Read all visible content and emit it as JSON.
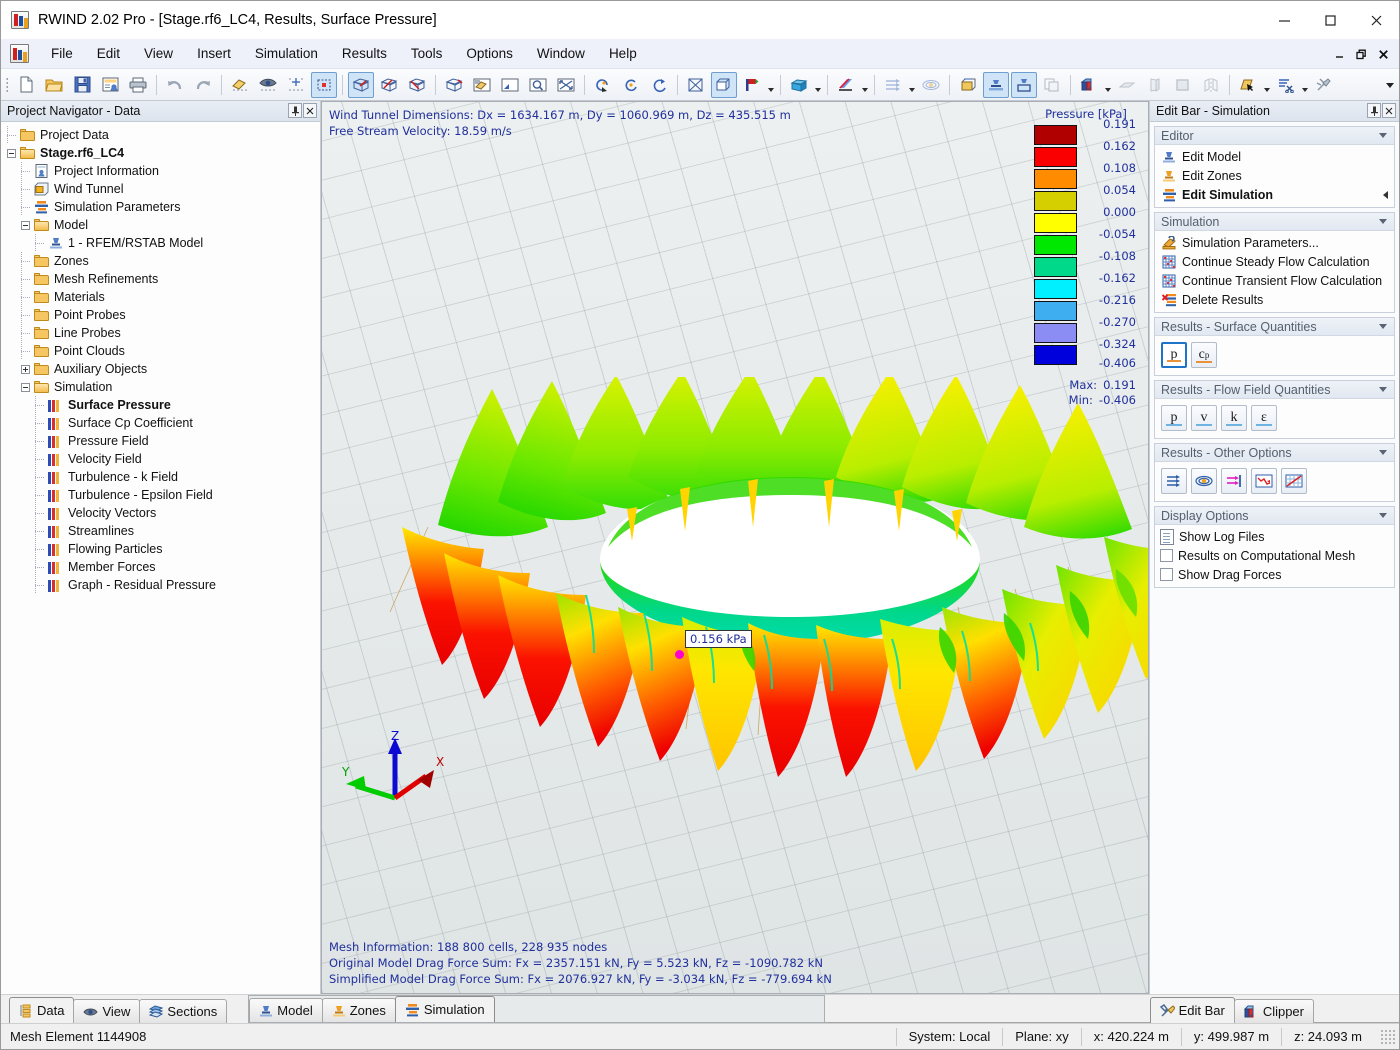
{
  "window": {
    "title": "RWIND 2.02 Pro - [Stage.rf6_LC4, Results, Surface Pressure]",
    "minimize": "—",
    "maximize": "☐",
    "close": "✕"
  },
  "mdi": {
    "minimize": "–",
    "restore": "❐",
    "close": "✕"
  },
  "menu": [
    {
      "label": "File"
    },
    {
      "label": "Edit"
    },
    {
      "label": "View"
    },
    {
      "label": "Insert"
    },
    {
      "label": "Simulation"
    },
    {
      "label": "Results"
    },
    {
      "label": "Tools"
    },
    {
      "label": "Options"
    },
    {
      "label": "Window"
    },
    {
      "label": "Help"
    }
  ],
  "toolbar": {
    "icons": [
      "new-file-icon",
      "open-folder-icon",
      "save-icon",
      "project-info-icon",
      "print-icon",
      "undo-icon",
      "redo-icon",
      "render-shaded-icon",
      "visibility-eye-icon",
      "snap-grid-icon",
      "select-region-icon",
      "view-iso-xyz-icon",
      "view-front-icon",
      "view-side-icon",
      "view-top-icon",
      "shading-icon",
      "zoom-window-icon",
      "zoom-detail-icon",
      "zoom-fit-icon",
      "rotate-left-icon",
      "rotate-right-icon",
      "rotate-around-icon",
      "wireframe-box-icon",
      "solid-box-icon",
      "color-flag-icon",
      "box-render-icon",
      "color-gradient-icon",
      "flow-arrows-icon",
      "flow-field-icon",
      "mesh-surface-icon",
      "mesh-model-icon",
      "mesh-zone-icon",
      "mesh-copy-icon",
      "clipper-box-icon",
      "plane-icon",
      "section-icon",
      "fill-icon",
      "mirror-icon",
      "pointer-surface-icon",
      "scissors-icon",
      "clean-icon"
    ]
  },
  "left_panel": {
    "title": "Project Navigator - Data",
    "pin_icon": "pin-icon",
    "close_icon": "close-icon",
    "tree": [
      {
        "label": "Project Data",
        "depth": 0,
        "icon": "folder-icon",
        "exp": "none",
        "bold": false
      },
      {
        "label": "Stage.rf6_LC4",
        "depth": 0,
        "icon": "folder-open-icon",
        "exp": "minus",
        "bold": true
      },
      {
        "label": "Project Information",
        "depth": 1,
        "icon": "project-info-icon",
        "exp": "none",
        "bold": false
      },
      {
        "label": "Wind Tunnel",
        "depth": 1,
        "icon": "wind-tunnel-icon",
        "exp": "none",
        "bold": false
      },
      {
        "label": "Simulation Parameters",
        "depth": 1,
        "icon": "sim-params-icon",
        "exp": "none",
        "bold": false
      },
      {
        "label": "Model",
        "depth": 1,
        "icon": "folder-open-icon",
        "exp": "minus",
        "bold": false
      },
      {
        "label": "1 - RFEM/RSTAB Model",
        "depth": 2,
        "icon": "model-icon",
        "exp": "none",
        "bold": false
      },
      {
        "label": "Zones",
        "depth": 1,
        "icon": "folder-icon",
        "exp": "none",
        "bold": false
      },
      {
        "label": "Mesh Refinements",
        "depth": 1,
        "icon": "folder-icon",
        "exp": "none",
        "bold": false
      },
      {
        "label": "Materials",
        "depth": 1,
        "icon": "folder-icon",
        "exp": "none",
        "bold": false
      },
      {
        "label": "Point Probes",
        "depth": 1,
        "icon": "folder-icon",
        "exp": "none",
        "bold": false
      },
      {
        "label": "Line Probes",
        "depth": 1,
        "icon": "folder-icon",
        "exp": "none",
        "bold": false
      },
      {
        "label": "Point Clouds",
        "depth": 1,
        "icon": "folder-icon",
        "exp": "none",
        "bold": false
      },
      {
        "label": "Auxiliary Objects",
        "depth": 1,
        "icon": "folder-icon",
        "exp": "plus",
        "bold": false
      },
      {
        "label": "Simulation",
        "depth": 1,
        "icon": "folder-open-icon",
        "exp": "minus",
        "bold": false
      },
      {
        "label": "Surface Pressure",
        "depth": 2,
        "icon": "results-bars-icon",
        "exp": "none",
        "bold": true
      },
      {
        "label": "Surface Cp Coefficient",
        "depth": 2,
        "icon": "results-bars-icon",
        "exp": "none",
        "bold": false
      },
      {
        "label": "Pressure Field",
        "depth": 2,
        "icon": "results-bars-icon",
        "exp": "none",
        "bold": false
      },
      {
        "label": "Velocity Field",
        "depth": 2,
        "icon": "results-bars-icon",
        "exp": "none",
        "bold": false
      },
      {
        "label": "Turbulence - k Field",
        "depth": 2,
        "icon": "results-bars-icon",
        "exp": "none",
        "bold": false
      },
      {
        "label": "Turbulence - Epsilon Field",
        "depth": 2,
        "icon": "results-bars-icon",
        "exp": "none",
        "bold": false
      },
      {
        "label": "Velocity Vectors",
        "depth": 2,
        "icon": "results-bars-icon",
        "exp": "none",
        "bold": false
      },
      {
        "label": "Streamlines",
        "depth": 2,
        "icon": "results-bars-icon",
        "exp": "none",
        "bold": false
      },
      {
        "label": "Flowing Particles",
        "depth": 2,
        "icon": "results-bars-icon",
        "exp": "none",
        "bold": false
      },
      {
        "label": "Member Forces",
        "depth": 2,
        "icon": "results-bars-icon",
        "exp": "none",
        "bold": false
      },
      {
        "label": "Graph - Residual Pressure",
        "depth": 2,
        "icon": "results-bars-icon",
        "exp": "none",
        "bold": false
      }
    ]
  },
  "viewport": {
    "top_info": "Wind Tunnel Dimensions: Dx = 1634.167 m, Dy = 1060.969 m, Dz = 435.515 m\nFree Stream Velocity: 18.59 m/s",
    "bottom_info": "Mesh Information: 188 800 cells, 228 935 nodes\nOriginal Model Drag Force Sum: Fx = 2357.151 kN, Fy = 5.523 kN, Fz = -1090.782 kN\nSimplified Model Drag Force Sum: Fx = 2076.927 kN, Fy = -3.034 kN, Fz = -779.694 kN",
    "probe_label": "0.156 kPa",
    "axes": {
      "x": "X",
      "y": "Y",
      "z": "Z"
    },
    "text_color": "#1f2f9c"
  },
  "chart_data": {
    "type": "heatmap",
    "title": "Pressure [kPa]",
    "unit": "kPa",
    "colorbar_values": [
      "0.191",
      "0.162",
      "0.108",
      "0.054",
      "0.000",
      "-0.054",
      "-0.108",
      "-0.162",
      "-0.216",
      "-0.270",
      "-0.324",
      "-0.406"
    ],
    "colorbar_colors": [
      "#b00000",
      "#fa0000",
      "#ff8c00",
      "#d6cf00",
      "#ffff00",
      "#00e800",
      "#00d98a",
      "#00f0ff",
      "#3eaef0",
      "#8c8cf5",
      "#0000dc"
    ],
    "max_label": "Max:",
    "max_value": "0.191",
    "min_label": "Min:",
    "min_value": "-0.406",
    "probe_value": 0.156,
    "probe_label": "0.156 kPa",
    "legend_position": "top-right"
  },
  "right_panel": {
    "title": "Edit Bar - Simulation",
    "groups": [
      {
        "name": "Editor",
        "rows": [
          {
            "label": "Edit Model",
            "icon": "model-icon",
            "bold": false,
            "caret": false
          },
          {
            "label": "Edit Zones",
            "icon": "zones-icon",
            "bold": false,
            "caret": false
          },
          {
            "label": "Edit Simulation",
            "icon": "sim-params-icon",
            "bold": true,
            "caret": true
          }
        ]
      },
      {
        "name": "Simulation",
        "rows": [
          {
            "label": "Simulation Parameters...",
            "icon": "sim-settings-icon",
            "bold": false,
            "caret": false
          },
          {
            "label": "Continue Steady Flow Calculation",
            "icon": "calc-mesh-icon",
            "bold": false,
            "caret": false
          },
          {
            "label": "Continue Transient Flow Calculation",
            "icon": "calc-mesh-icon",
            "bold": false,
            "caret": false
          },
          {
            "label": "Delete Results",
            "icon": "delete-results-icon",
            "bold": false,
            "caret": false
          }
        ]
      },
      {
        "name": "Results - Surface Quantities",
        "buttons": [
          {
            "label": "p",
            "sub": "",
            "selected": true,
            "accent": "orange",
            "icon": "pressure-p-icon"
          },
          {
            "label": "c",
            "sub": "p",
            "selected": false,
            "accent": "orange",
            "icon": "cp-coefficient-icon"
          }
        ]
      },
      {
        "name": "Results - Flow Field Quantities",
        "buttons": [
          {
            "label": "p",
            "sub": "",
            "selected": false,
            "accent": "blue",
            "icon": "flow-pressure-icon"
          },
          {
            "label": "v",
            "sub": "",
            "selected": false,
            "accent": "blue",
            "icon": "flow-velocity-icon"
          },
          {
            "label": "k",
            "sub": "",
            "selected": false,
            "accent": "blue",
            "icon": "turbulence-k-icon"
          },
          {
            "label": "ε",
            "sub": "",
            "selected": false,
            "accent": "blue",
            "icon": "turbulence-epsilon-icon"
          }
        ]
      },
      {
        "name": "Results - Other Options",
        "icon_buttons": [
          "velocity-vectors-icon",
          "flowing-particles-icon",
          "streamlines-icon",
          "residual-graph-icon",
          "diagram-icon"
        ]
      },
      {
        "name": "Display Options",
        "checks": [
          {
            "label": "Show Log Files",
            "type": "doc",
            "checked": false
          },
          {
            "label": "Results on Computational Mesh",
            "type": "check",
            "checked": false
          },
          {
            "label": "Show Drag Forces",
            "type": "check",
            "checked": false
          }
        ]
      }
    ]
  },
  "bottom_tabs": {
    "left": [
      {
        "label": "Data",
        "icon": "data-tree-icon",
        "selected": true
      },
      {
        "label": "View",
        "icon": "eye-icon",
        "selected": false
      },
      {
        "label": "Sections",
        "icon": "sections-icon",
        "selected": false
      }
    ],
    "center": [
      {
        "label": "Model",
        "icon": "model-icon",
        "selected": false
      },
      {
        "label": "Zones",
        "icon": "zones-icon",
        "selected": false
      },
      {
        "label": "Simulation",
        "icon": "sim-params-icon",
        "selected": true
      }
    ],
    "right": [
      {
        "label": "Edit Bar",
        "icon": "tools-icon",
        "selected": true
      },
      {
        "label": "Clipper",
        "icon": "clipper-icon",
        "selected": false
      }
    ]
  },
  "statusbar": {
    "message": "Mesh Element 1144908",
    "cells": [
      {
        "label": "System: Local"
      },
      {
        "label": "Plane: xy"
      },
      {
        "label": "x:  420.224 m"
      },
      {
        "label": "y:  499.987 m"
      },
      {
        "label": "z:  24.093 m"
      }
    ]
  }
}
